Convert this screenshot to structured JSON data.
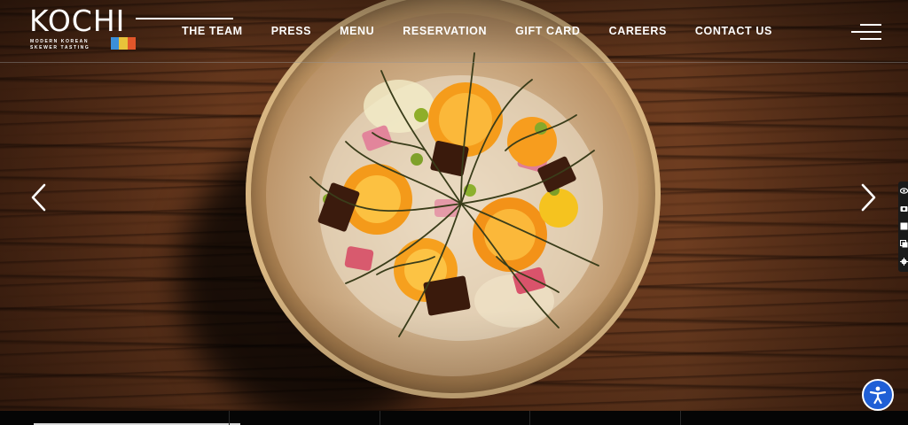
{
  "brand": {
    "name": "KOCHI",
    "tagline_line1": "MODERN KOREAN",
    "tagline_line2": "SKEWER TASTING",
    "badge_colors": [
      "#3b8fd9",
      "#e8c23a",
      "#e2562a"
    ]
  },
  "nav": {
    "items": [
      {
        "label": "THE TEAM"
      },
      {
        "label": "PRESS"
      },
      {
        "label": "MENU"
      },
      {
        "label": "RESERVATION"
      },
      {
        "label": "GIFT CARD"
      },
      {
        "label": "CAREERS"
      },
      {
        "label": "CONTACT US"
      }
    ],
    "menu_icon": "hamburger-menu-icon"
  },
  "slider": {
    "prev_icon": "chevron-left-icon",
    "next_icon": "chevron-right-icon",
    "image_description_icon": "hero-food-image"
  },
  "side_tools": [
    {
      "icon": "eye-icon"
    },
    {
      "icon": "camera-icon"
    },
    {
      "icon": "square-icon"
    },
    {
      "icon": "copy-icon"
    },
    {
      "icon": "gear-icon"
    }
  ],
  "accessibility": {
    "icon": "accessibility-icon",
    "color": "#1f5fd6"
  },
  "colors": {
    "nav_text": "#ffffff",
    "wood_dark": "#4a2613",
    "wood_light": "#6e3d20"
  }
}
